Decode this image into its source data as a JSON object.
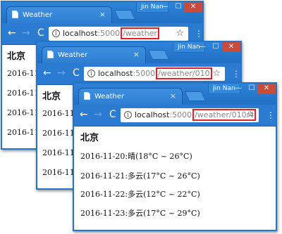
{
  "windows": [
    {
      "tab_title": "Weather",
      "tab_close": "×",
      "user": "Jin Nan",
      "controls": {
        "minimize": "—",
        "maximize": "☐",
        "close": "✕"
      },
      "nav": {
        "back": "←",
        "forward": "→",
        "reload": "C"
      },
      "url": {
        "host": "localhost",
        "port": ":5000",
        "path": "/weather"
      },
      "star": "☆",
      "menu": "⋮",
      "content": {
        "heading": "北京",
        "days": [
          "2016-11-",
          "2016-11-",
          "2016-11-",
          "2016-11-"
        ]
      }
    },
    {
      "tab_title": "Weather",
      "tab_close": "×",
      "user": "Jin Nan",
      "controls": {
        "minimize": "—",
        "maximize": "☐",
        "close": "✕"
      },
      "nav": {
        "back": "←",
        "forward": "→",
        "reload": "C"
      },
      "url": {
        "host": "localhost",
        "port": ":5000",
        "path": "/weather/010"
      },
      "star": "☆",
      "menu": "⋮",
      "content": {
        "heading": "北京",
        "days": [
          "2016-11-",
          "2016-11-",
          "2016-11-",
          "2016-11-"
        ]
      }
    },
    {
      "tab_title": "Weather",
      "tab_close": "×",
      "user": "Jin Nan",
      "controls": {
        "minimize": "—",
        "maximize": "☐",
        "close": "✕"
      },
      "nav": {
        "back": "←",
        "forward": "→",
        "reload": "C"
      },
      "url": {
        "host": "localhost",
        "port": ":5000",
        "path": "/weather/010/4"
      },
      "star": "☆",
      "menu": "⋮",
      "content": {
        "heading": "北京",
        "days": [
          "2016-11-20:晴(18°C ~ 26°C)",
          "2016-11-21:多云(17°C ~ 26°C)",
          "2016-11-22:多云(12°C ~ 22°C)",
          "2016-11-23:多云(17°C ~ 29°C)"
        ]
      }
    }
  ],
  "icons": {
    "tab_favicon": "document-icon",
    "info": "info-icon",
    "star": "bookmark-star-icon",
    "menu": "kebab-menu-icon"
  },
  "colors": {
    "titlebar": "#2f83d8",
    "toolbar": "#2c7bd2",
    "url_highlight": "#e0202a",
    "close_button": "#c94b3c"
  }
}
